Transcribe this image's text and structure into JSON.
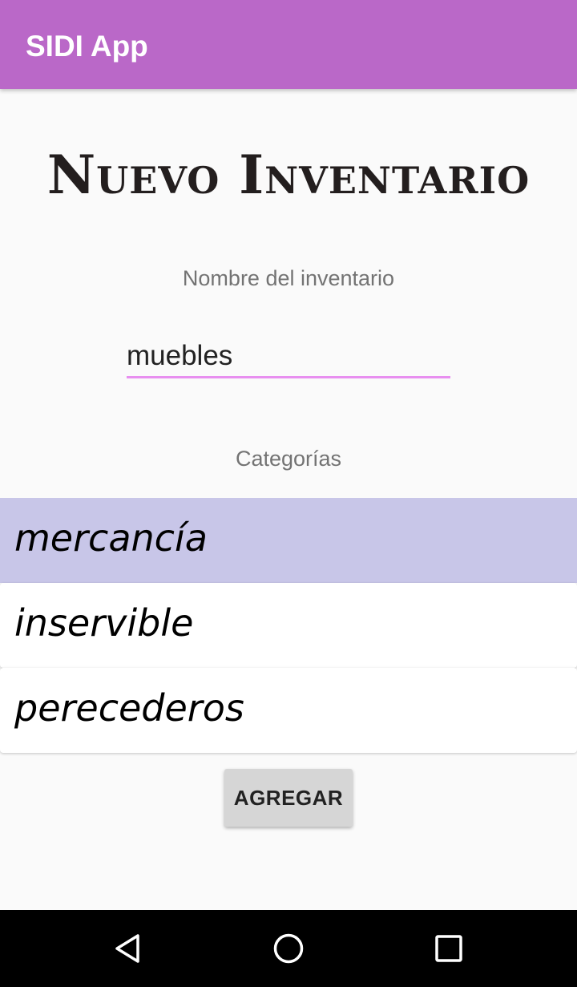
{
  "app_bar": {
    "title": "SIDI App",
    "color": "#ba68c8"
  },
  "page": {
    "title": "Nuevo Inventario"
  },
  "name_field": {
    "label": "Nombre del inventario",
    "value": "muebles",
    "accent_color": "#e88ff0"
  },
  "categories": {
    "label": "Categorías",
    "items": [
      {
        "label": "mercancía",
        "selected": true
      },
      {
        "label": "inservible",
        "selected": false
      },
      {
        "label": "perecederos",
        "selected": false
      }
    ],
    "selected_color": "#c8c6e8"
  },
  "actions": {
    "add_label": "AGREGAR"
  },
  "nav_bar": {
    "back_icon": "triangle-back-icon",
    "home_icon": "circle-home-icon",
    "recents_icon": "square-recents-icon"
  }
}
